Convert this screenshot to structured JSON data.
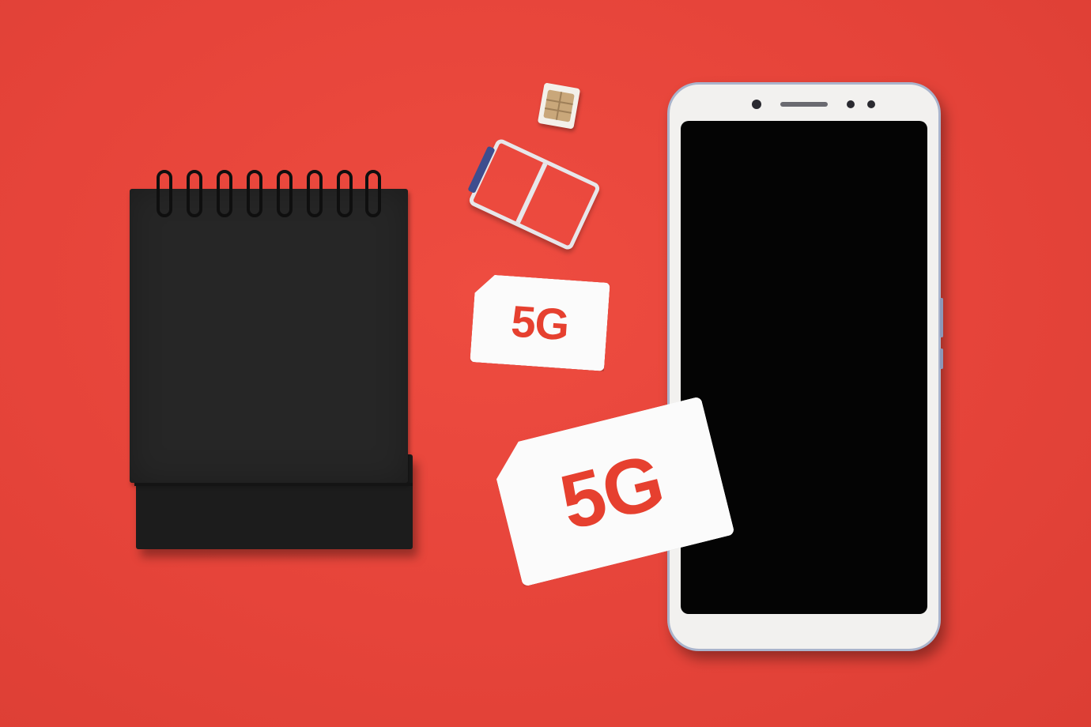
{
  "scene": {
    "background_color": "#e8453a",
    "objects": [
      "notebook",
      "sim-chip",
      "sim-tray",
      "5g-card-small",
      "5g-card-large",
      "smartphone"
    ]
  },
  "cards": {
    "small_label": "5G",
    "large_label": "5G",
    "text_color": "#e6402f"
  },
  "phone": {
    "body_color": "#f2f1ef",
    "screen_color": "#040404"
  },
  "notebook": {
    "cover_color": "#262626",
    "coil_count": 8
  }
}
